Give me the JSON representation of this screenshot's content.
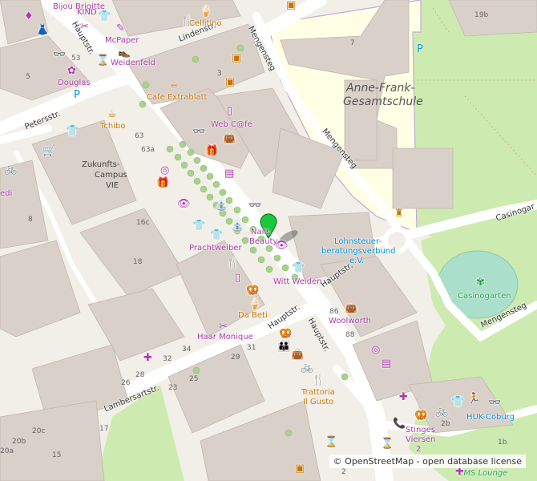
{
  "map": {
    "schools": {
      "line1": "Anne-Frank-",
      "line2": "Gesamtschule"
    },
    "streets": {
      "lindenstr": "Lindenstr.",
      "mengensteg_top": "Mengensteg",
      "mengensteg_mid": "Mengensteg",
      "mengensteg_bottom": "Mengensteg",
      "petersstr": "Petersstr.",
      "hauptstr_top": "Hauptstr.",
      "hauptstr_mid": "Hauptstr.",
      "hauptstr_right": "Hauptstr.",
      "hauptstr_low": "Hauptstr.",
      "lambersartstr": "Lambersartstr.",
      "casinogarten_road": "Casinogar"
    },
    "pois": {
      "bijou": {
        "line1": "Bijou Brigitte",
        "line2": "KIND"
      },
      "cellitino": "Cellitino",
      "mcpaper": "McPaper",
      "weidenfeld": "Weidenfeld",
      "douglas": "Douglas",
      "cafe_extrablatt": "Cafe Extrablatt",
      "tchibo": "Tchibo",
      "webcafe": "Web C@fe",
      "zukunft": {
        "line1": "Zukunfts-",
        "line2": "Campus",
        "line3": "VIE"
      },
      "nails": {
        "line1": "Nails",
        "line2": "Beauty"
      },
      "lohnsteuer": {
        "line1": "Lohnsteuer-",
        "line2": "beratungsverbund",
        "line3": "e.V."
      },
      "prachtweiber": "Prachtweiber",
      "witt": "Witt Weiden",
      "dabeti": "Da Beti",
      "woolworth": "Woolworth",
      "haar": "Haar Monique",
      "trattoria": {
        "line1": "Trattoria",
        "line2": "Il Gusto"
      },
      "casinogarten": "Casinogarten",
      "huk": "HUK-Coburg",
      "stinges": {
        "line1": "Stinges",
        "line2": "Viersen",
        "line3": "2"
      },
      "ems": "EMS Lounge",
      "edi": "edi"
    },
    "house_numbers": [
      "19b",
      "7",
      "53",
      "5",
      "3",
      "63",
      "63a",
      "8",
      "16c",
      "18",
      "86",
      "88",
      "34",
      "32",
      "31",
      "29",
      "28",
      "26",
      "25",
      "23",
      "20c",
      "20b",
      "20a",
      "17",
      "15",
      "2b",
      "1b",
      "2"
    ]
  },
  "attribution": "© OpenStreetMap - open database license"
}
